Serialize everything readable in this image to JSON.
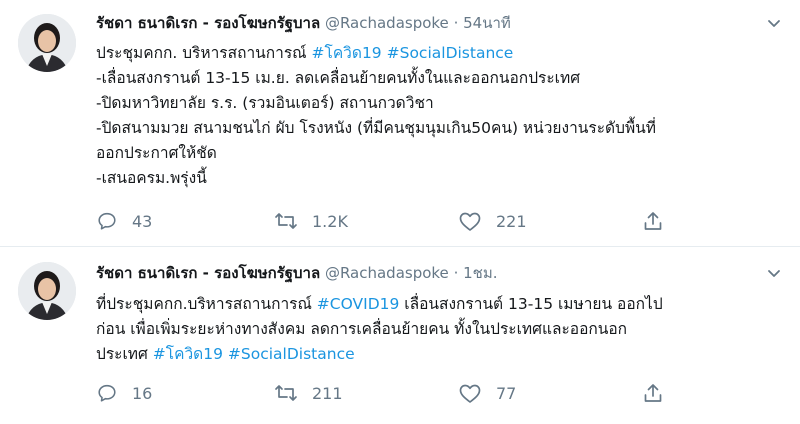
{
  "tweets": [
    {
      "name": "รัชดา ธนาดิเรก - รองโฆษกรัฐบาล",
      "handle": "@Rachadaspoke",
      "sep": "·",
      "time": "54นาที",
      "lines": [
        [
          {
            "text": "ประชุมคกก. บริหารสถานการณ์ ",
            "tag": false
          },
          {
            "text": "#โควิด19",
            "tag": true
          },
          {
            "text": " ",
            "tag": false
          },
          {
            "text": "#SocialDistance",
            "tag": true
          }
        ],
        [
          {
            "text": "-เลื่อนสงกรานต์ 13-15 เม.ย. ลดเคลื่อนย้ายคนทั้งในและออกนอกประเทศ",
            "tag": false
          }
        ],
        [
          {
            "text": "-ปิดมหาวิทยาลัย ร.ร. (รวมอินเตอร์) สถานกวดวิชา",
            "tag": false
          }
        ],
        [
          {
            "text": "-ปิดสนามมวย สนามชนไก่ ผับ โรงหนัง (ที่มีคนชุมนุมเกิน50คน) หน่วยงานระดับพื้นที่",
            "tag": false
          }
        ],
        [
          {
            "text": "ออกประกาศให้ชัด",
            "tag": false
          }
        ],
        [
          {
            "text": "-เสนอครม.พรุ่งนี้",
            "tag": false
          }
        ]
      ],
      "replies": "43",
      "retweets": "1.2K",
      "likes": "221"
    },
    {
      "name": "รัชดา ธนาดิเรก - รองโฆษกรัฐบาล",
      "handle": "@Rachadaspoke",
      "sep": "·",
      "time": "1ชม.",
      "lines": [
        [
          {
            "text": "ที่ประชุมคกก.บริหารสถานการณ์ ",
            "tag": false
          },
          {
            "text": "#COVID19",
            "tag": true
          },
          {
            "text": " เลื่อนสงกรานต์ 13-15 เมษายน ออกไป",
            "tag": false
          }
        ],
        [
          {
            "text": "ก่อน เพื่อเพิ่มระยะห่างทางสังคม ลดการเคลื่อนย้ายคน ทั้งในประเทศและออกนอก",
            "tag": false
          }
        ],
        [
          {
            "text": "ประเทศ ",
            "tag": false
          },
          {
            "text": "#โควิด19",
            "tag": true
          },
          {
            "text": " ",
            "tag": false
          },
          {
            "text": "#SocialDistance",
            "tag": true
          }
        ]
      ],
      "replies": "16",
      "retweets": "211",
      "likes": "77"
    }
  ],
  "icons": {
    "reply": "reply-icon",
    "retweet": "retweet-icon",
    "like": "heart-icon",
    "share": "share-icon",
    "more": "chevron-down-icon"
  },
  "colors": {
    "hashtag": "#1b95e0",
    "meta": "#657786",
    "text": "#14171a",
    "divider": "#e6ecf0"
  }
}
